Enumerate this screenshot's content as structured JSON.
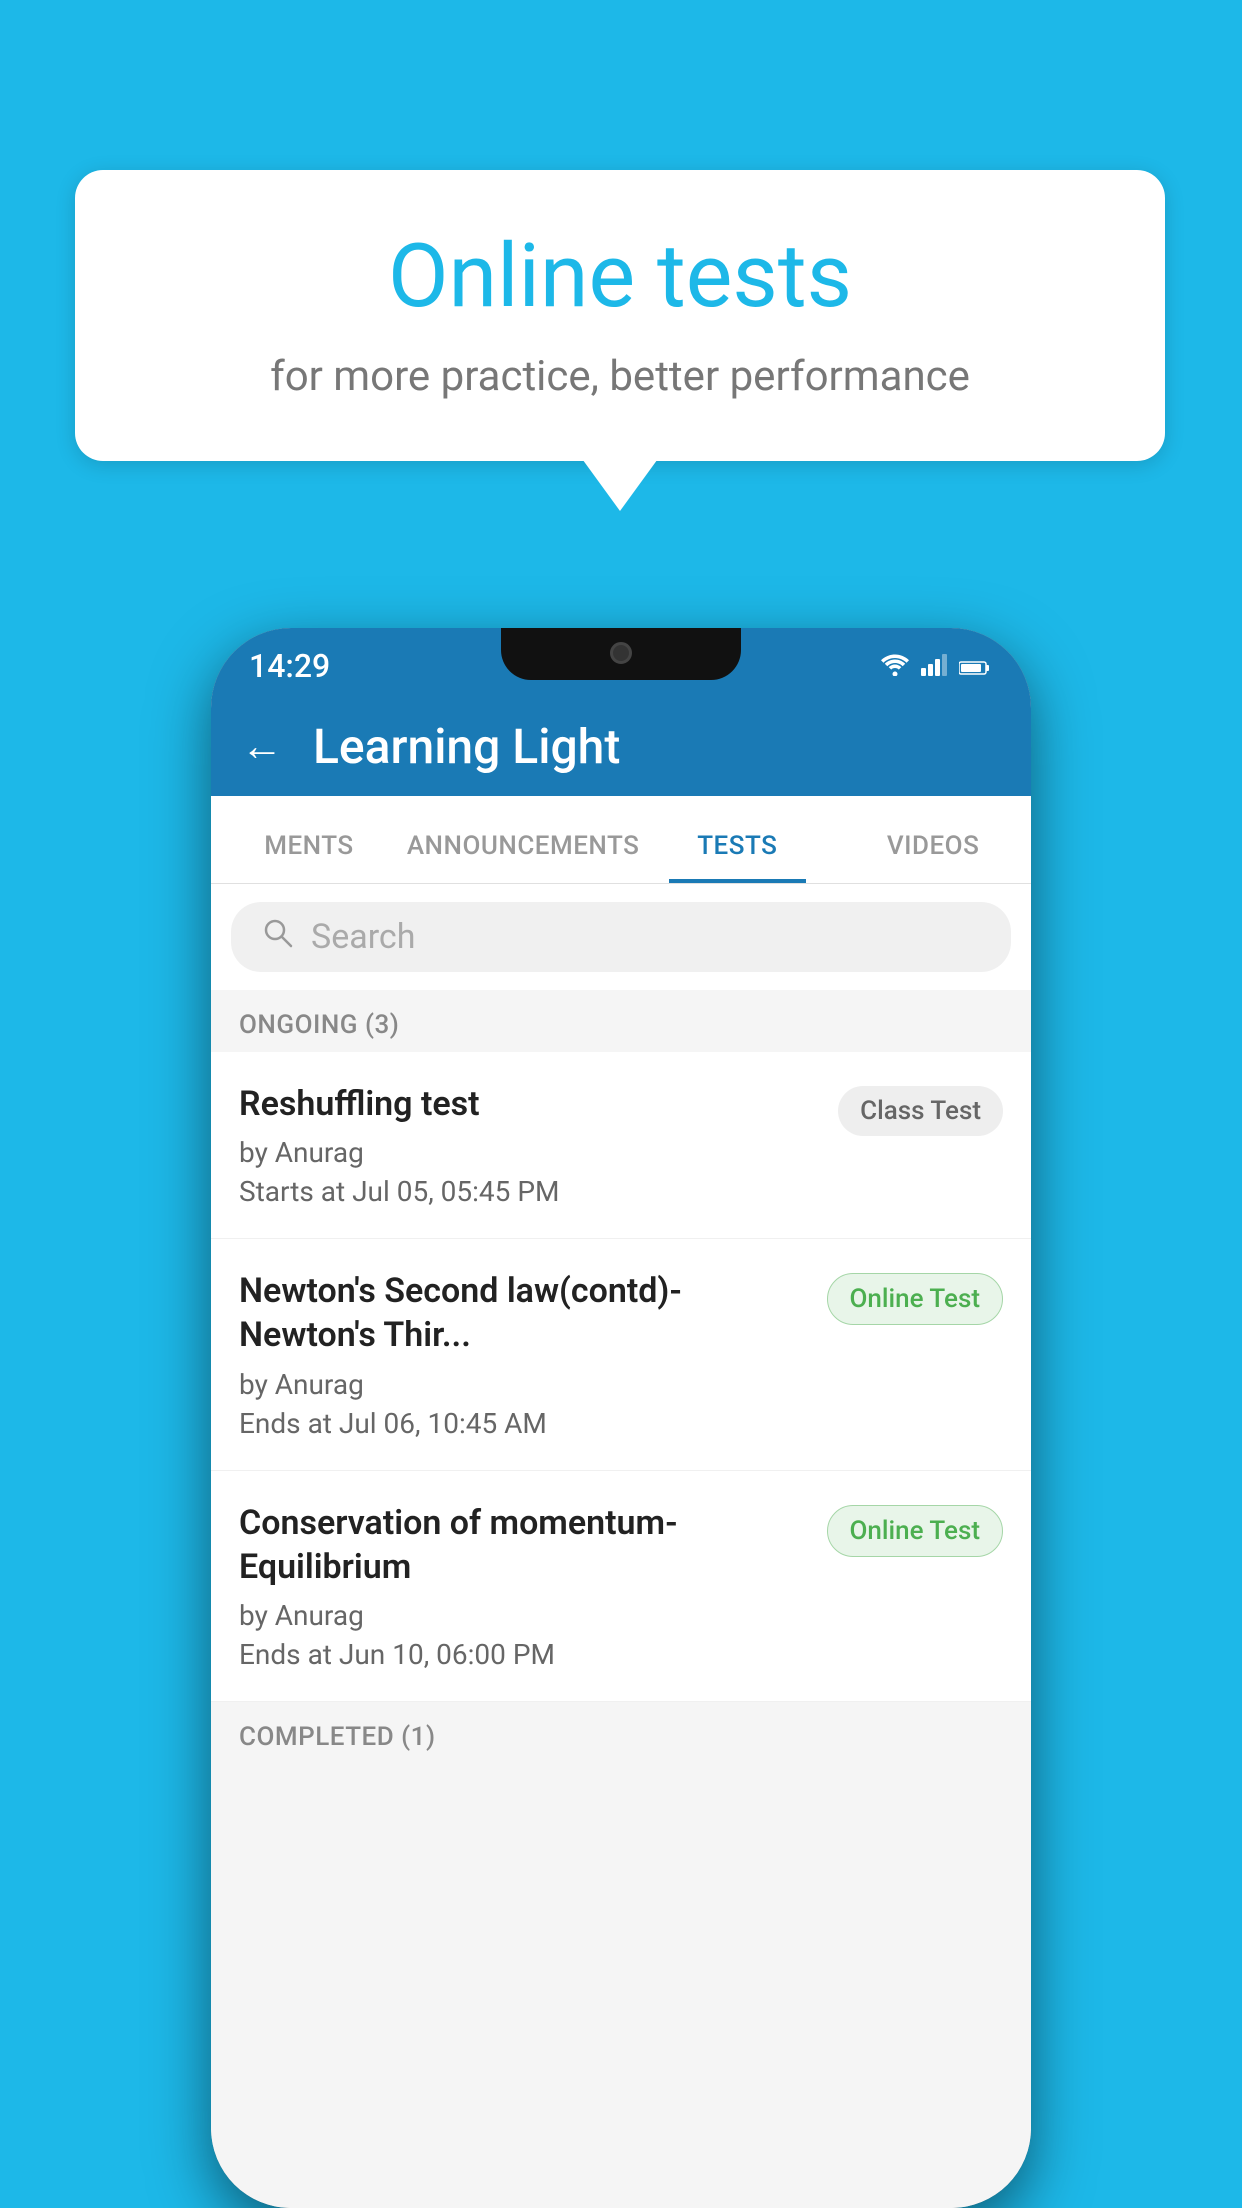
{
  "background_color": "#1DB8E8",
  "speech_bubble": {
    "title": "Online tests",
    "subtitle": "for more practice, better performance"
  },
  "phone": {
    "status_bar": {
      "time": "14:29",
      "icons": [
        "wifi",
        "signal",
        "battery"
      ]
    },
    "app_bar": {
      "title": "Learning Light",
      "back_label": "←"
    },
    "tabs": [
      {
        "label": "MENTS",
        "active": false
      },
      {
        "label": "ANNOUNCEMENTS",
        "active": false
      },
      {
        "label": "TESTS",
        "active": true
      },
      {
        "label": "VIDEOS",
        "active": false
      }
    ],
    "search": {
      "placeholder": "Search"
    },
    "ongoing_section": {
      "title": "ONGOING (3)",
      "items": [
        {
          "name": "Reshuffling test",
          "author": "by Anurag",
          "time_label": "Starts at",
          "time_value": "Jul 05, 05:45 PM",
          "badge": "Class Test",
          "badge_type": "class"
        },
        {
          "name": "Newton's Second law(contd)-Newton's Thir...",
          "author": "by Anurag",
          "time_label": "Ends at",
          "time_value": "Jul 06, 10:45 AM",
          "badge": "Online Test",
          "badge_type": "online"
        },
        {
          "name": "Conservation of momentum-Equilibrium",
          "author": "by Anurag",
          "time_label": "Ends at",
          "time_value": "Jun 10, 06:00 PM",
          "badge": "Online Test",
          "badge_type": "online"
        }
      ]
    },
    "completed_section": {
      "title": "COMPLETED (1)"
    }
  }
}
